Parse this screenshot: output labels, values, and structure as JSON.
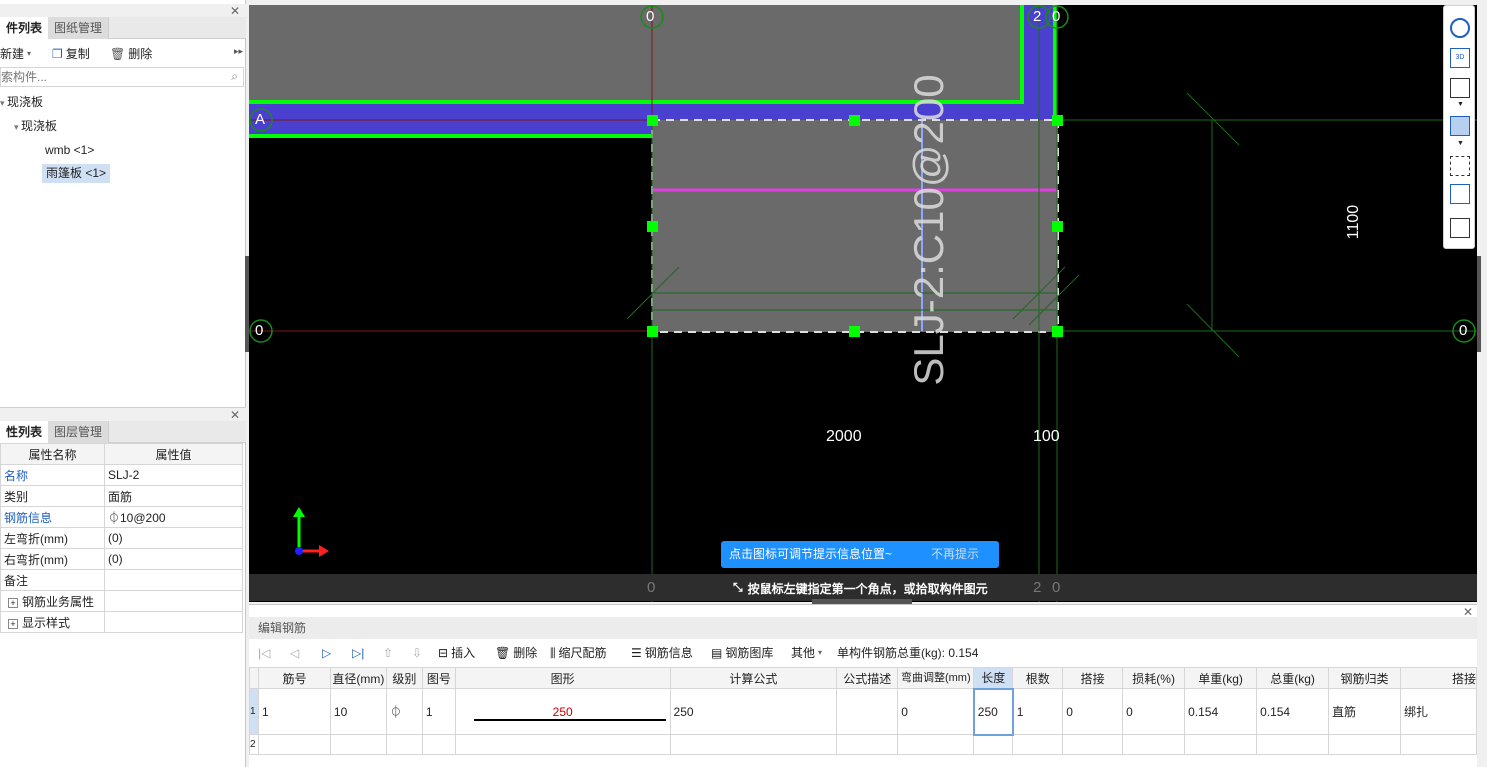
{
  "left_top": {
    "tab_active": "件列表",
    "tab_inactive": "图纸管理",
    "new_label": "新建",
    "copy_label": "复制",
    "delete_label": "删除",
    "search_placeholder": "索构件...",
    "tree": [
      "现浇板",
      "现浇板",
      "wmb <1>",
      "雨篷板 <1>"
    ]
  },
  "left_bottom": {
    "tab_active": "性列表",
    "tab_inactive": "图层管理",
    "col_name": "属性名称",
    "col_value": "属性值",
    "rows": [
      {
        "name": "名称",
        "value": "SLJ-2"
      },
      {
        "name": "类别",
        "value": "面筋"
      },
      {
        "name": "钢筋信息",
        "value": "⏀10@200"
      },
      {
        "name": "左弯折(mm)",
        "value": "(0)"
      },
      {
        "name": "右弯折(mm)",
        "value": "(0)"
      },
      {
        "name": "备注",
        "value": ""
      },
      {
        "name": "钢筋业务属性",
        "value": ""
      },
      {
        "name": "显示样式",
        "value": ""
      }
    ]
  },
  "canvas": {
    "axis_top_left": "0",
    "axis_top_mid_2": "2",
    "axis_top_mid_0": "0",
    "axis_left_A": "A",
    "axis_left_0": "0",
    "axis_right_0": "0",
    "axis_bottom_0": "0",
    "axis_bottom_2": "2",
    "axis_bottom_0b": "0",
    "rebar_label": "SLJ-2:C10@200",
    "dim_2000": "2000",
    "dim_100": "100",
    "dim_1100": "1100",
    "tip_text": "点击图标可调节提示信息位置~",
    "tip_dismiss": "不再提示",
    "status_text": "按鼠标左键指定第一个角点，或拾取构件图元",
    "colors": {
      "green": "#00ff00",
      "blue_slab": "#4b3fd0",
      "magenta": "#e040e0",
      "grid": "#1a6b1a",
      "gray": "#6a6a6a"
    }
  },
  "bottom": {
    "title": "编辑钢筋",
    "insert": "插入",
    "delete": "删除",
    "scale": "缩尺配筋",
    "info": "钢筋信息",
    "library": "钢筋图库",
    "other": "其他",
    "total_weight": "单构件钢筋总重(kg): 0.154",
    "headers": [
      "筋号",
      "直径(mm)",
      "级别",
      "图号",
      "图形",
      "计算公式",
      "公式描述",
      "弯曲调整(mm)",
      "长度",
      "根数",
      "搭接",
      "损耗(%)",
      "单重(kg)",
      "总重(kg)",
      "钢筋归类",
      "搭接"
    ],
    "row1": [
      "1",
      "10",
      "⏀",
      "1",
      "250",
      "250",
      "",
      "0",
      "250",
      "1",
      "0",
      "0",
      "0.154",
      "0.154",
      "直筋",
      "绑扎"
    ],
    "row2_index": "2",
    "row1_index": "1"
  }
}
